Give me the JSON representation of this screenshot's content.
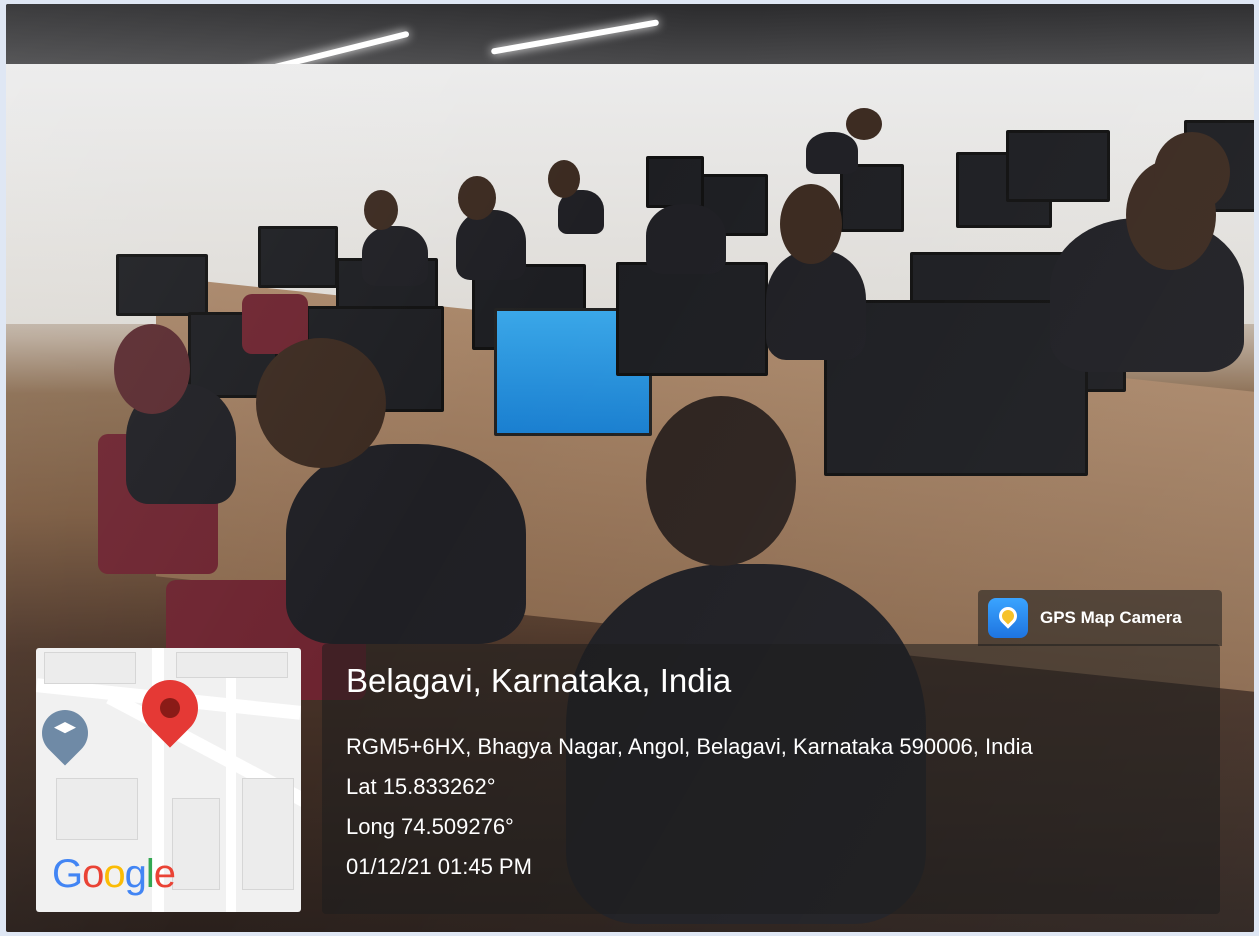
{
  "badge": {
    "app_name": "GPS Map Camera",
    "icon": "gps-map-camera-icon"
  },
  "map": {
    "logo_text": "Google",
    "pins": [
      "education-pin-icon",
      "location-pin-icon"
    ]
  },
  "location": {
    "title": "Belagavi, Karnataka, India",
    "address": "RGM5+6HX, Bhagya Nagar, Angol, Belagavi, Karnataka 590006, India",
    "latitude": "Lat 15.833262°",
    "longitude": "Long 74.509276°",
    "timestamp": "01/12/21 01:45 PM"
  },
  "colors": {
    "overlay": "#1e1e1e",
    "pin_red": "#e53935",
    "page_bg": "#dfe7f4"
  }
}
